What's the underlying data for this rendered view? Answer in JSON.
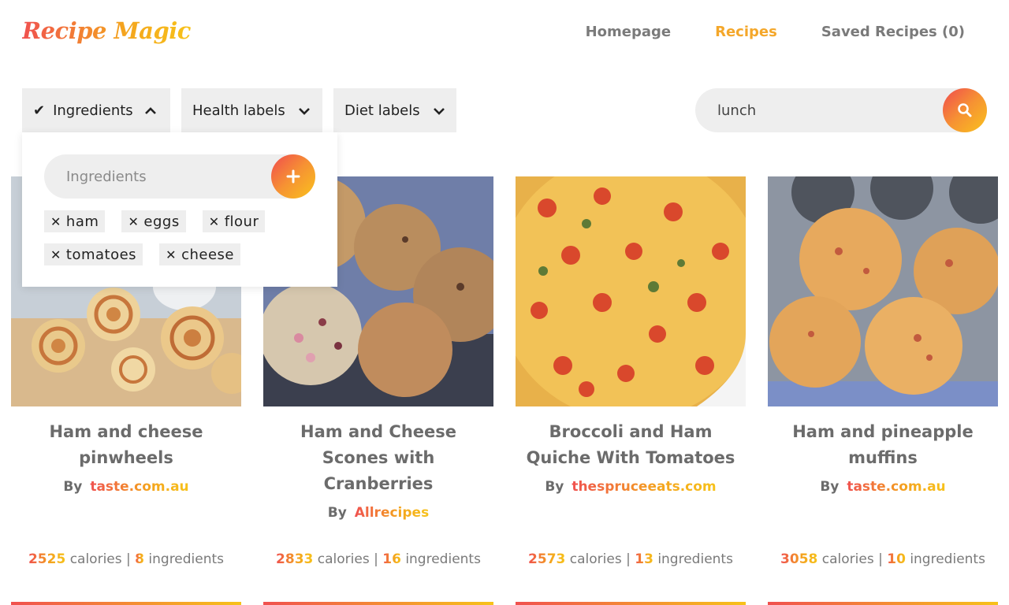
{
  "header": {
    "logo": "Recipe Magic",
    "nav": [
      {
        "label": "Homepage",
        "active": false
      },
      {
        "label": "Recipes",
        "active": true
      },
      {
        "label": "Saved Recipes (0)",
        "active": false
      }
    ]
  },
  "filters": {
    "ingredients": {
      "label": "Ingredients",
      "check_icon": "check-icon",
      "chevron_icon": "chevron-up-icon"
    },
    "health": {
      "label": "Health labels",
      "chevron_icon": "chevron-down-icon"
    },
    "diet": {
      "label": "Diet labels",
      "chevron_icon": "chevron-down-icon"
    }
  },
  "search": {
    "value": "lunch",
    "icon": "search-icon"
  },
  "ingredients_panel": {
    "placeholder": "Ingredients",
    "add_icon": "plus-icon",
    "tags": [
      "ham",
      "eggs",
      "flour",
      "tomatoes",
      "cheese"
    ]
  },
  "recipes": [
    {
      "title": "Ham and cheese pinwheels",
      "by": "By",
      "source": "taste.com.au",
      "calories": "2525",
      "calories_label": "calories |",
      "ingredients": "8",
      "ingredients_label": "ingredients"
    },
    {
      "title": "Ham and Cheese Scones with Cranberries",
      "by": "By",
      "source": "Allrecipes",
      "calories": "2833",
      "calories_label": "calories |",
      "ingredients": "16",
      "ingredients_label": "ingredients"
    },
    {
      "title": "Broccoli and Ham Quiche With Tomatoes",
      "by": "By",
      "source": "thespruceeats.com",
      "calories": "2573",
      "calories_label": "calories |",
      "ingredients": "13",
      "ingredients_label": "ingredients"
    },
    {
      "title": "Ham and pineapple muffins",
      "by": "By",
      "source": "taste.com.au",
      "calories": "3058",
      "calories_label": "calories |",
      "ingredients": "10",
      "ingredients_label": "ingredients"
    }
  ],
  "colors": {
    "accent": "#f4a72a",
    "gradient_start": "#f0514f",
    "gradient_end": "#f7c21a",
    "chip_bg": "#eeeeee"
  }
}
